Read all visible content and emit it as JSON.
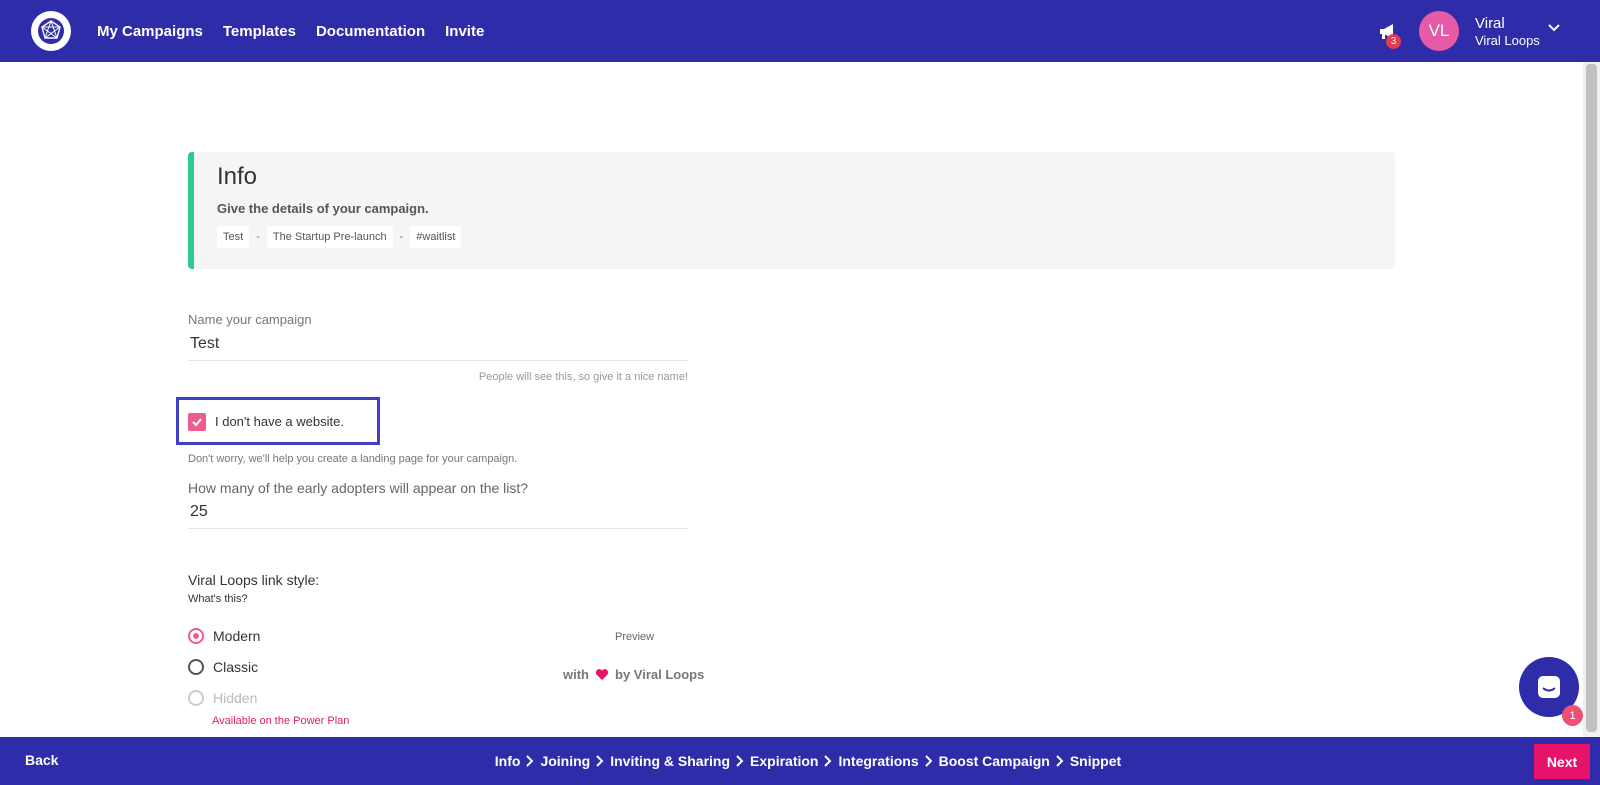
{
  "nav": {
    "links": [
      "My Campaigns",
      "Templates",
      "Documentation",
      "Invite"
    ],
    "notification_count": "3",
    "user": {
      "initials": "VL",
      "name": "Viral",
      "org": "Viral Loops"
    },
    "icons": {
      "logo": "viral-loops-logo",
      "notifications": "megaphone-icon",
      "menu": "chevron-down-icon"
    }
  },
  "info_card": {
    "title": "Info",
    "subtitle": "Give the details of your campaign.",
    "crumbs": [
      "Test",
      "The Startup Pre-launch",
      "#waitlist"
    ],
    "separator": "-"
  },
  "form": {
    "name_label": "Name your campaign",
    "name_value": "Test",
    "name_hint": "People will see this, so give it a nice name!",
    "no_website_label": "I don't have a website.",
    "no_website_checked": true,
    "no_website_hint": "Don't worry, we'll help you create a landing page for your campaign.",
    "early_adopters_label": "How many of the early adopters will appear on the list?",
    "early_adopters_value": "25",
    "link_style_label": "Viral Loops link style:",
    "whats_this": "What's this?",
    "link_style_options": [
      {
        "label": "Modern",
        "selected": true,
        "disabled": false
      },
      {
        "label": "Classic",
        "selected": false,
        "disabled": false
      },
      {
        "label": "Hidden",
        "selected": false,
        "disabled": true
      }
    ],
    "hidden_note": "Available on the Power Plan",
    "preview_label": "Preview",
    "preview_badge": {
      "with": "with",
      "by": "by Viral Loops"
    }
  },
  "chat": {
    "badge_count": "1"
  },
  "footer": {
    "back": "Back",
    "next": "Next",
    "steps": [
      "Info",
      "Joining",
      "Inviting & Sharing",
      "Expiration",
      "Integrations",
      "Boost Campaign",
      "Snippet"
    ]
  },
  "colors": {
    "primary": "#2e2ca9",
    "accent_pink": "#e7136b",
    "checkbox_pink": "#ef5b8f",
    "info_border_green": "#2bcb8e"
  }
}
